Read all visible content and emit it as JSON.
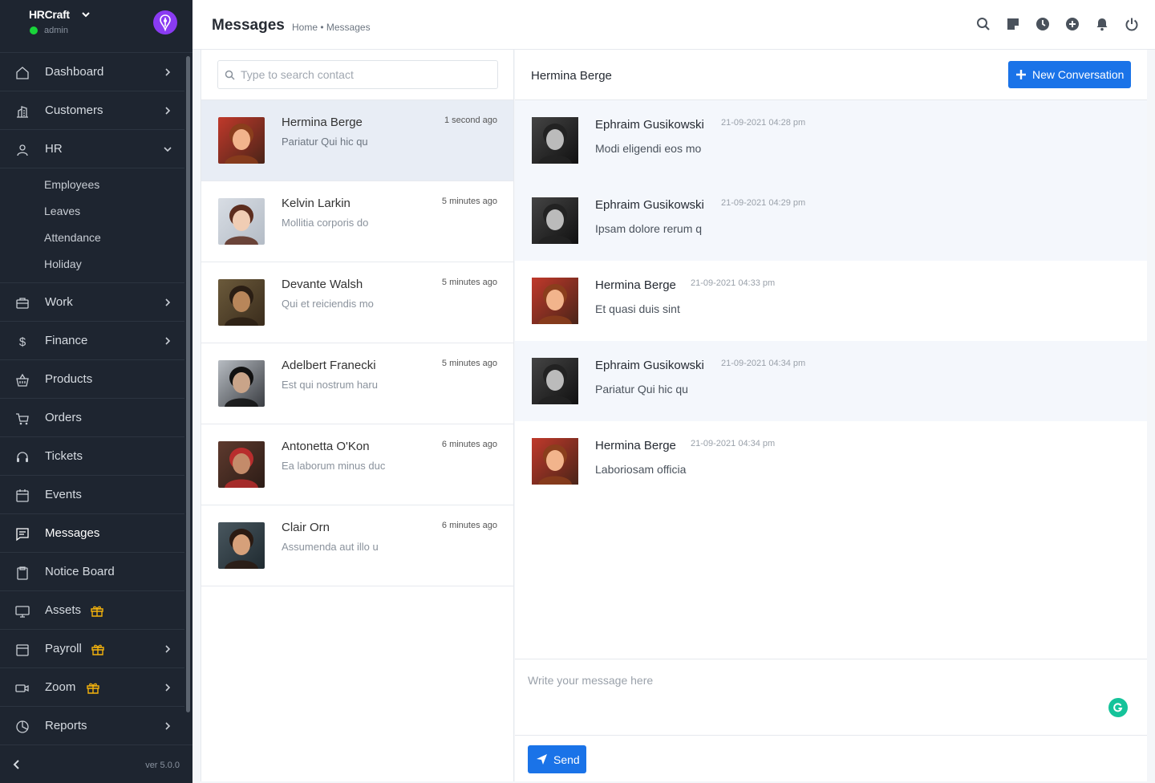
{
  "app": {
    "brand_name": "HRCraft",
    "user_role": "admin",
    "version": "ver 5.0.0",
    "accent_color": "#1a73e8",
    "sidebar_color": "#1e2530",
    "online_color": "#19d43a"
  },
  "sidebar": {
    "items": [
      {
        "label": "Dashboard",
        "icon": "home-icon"
      },
      {
        "label": "Customers",
        "icon": "building-icon"
      },
      {
        "label": "HR",
        "icon": "user-icon",
        "expanded": true,
        "children": [
          "Employees",
          "Leaves",
          "Attendance",
          "Holiday"
        ]
      },
      {
        "label": "Work",
        "icon": "briefcase-icon"
      },
      {
        "label": "Finance",
        "icon": "dollar-icon"
      },
      {
        "label": "Products",
        "icon": "basket-icon"
      },
      {
        "label": "Orders",
        "icon": "cart-icon"
      },
      {
        "label": "Tickets",
        "icon": "headset-icon"
      },
      {
        "label": "Events",
        "icon": "calendar-icon"
      },
      {
        "label": "Messages",
        "icon": "message-icon",
        "active": true
      },
      {
        "label": "Notice Board",
        "icon": "clipboard-icon"
      },
      {
        "label": "Assets",
        "icon": "monitor-icon",
        "badge": "gift-icon"
      },
      {
        "label": "Payroll",
        "icon": "wallet-icon",
        "badge": "gift-icon"
      },
      {
        "label": "Zoom",
        "icon": "video-icon",
        "badge": "gift-icon"
      },
      {
        "label": "Reports",
        "icon": "pie-chart-icon"
      }
    ]
  },
  "header": {
    "title": "Messages",
    "breadcrumb": "Home • Messages",
    "icons": [
      "search-icon",
      "sticky-note-icon",
      "clock-icon",
      "plus-circle-icon",
      "bell-icon",
      "power-icon"
    ]
  },
  "contacts": {
    "search_placeholder": "Type to search contact",
    "list": [
      {
        "name": "Hermina Berge",
        "preview": "Pariatur Qui hic qu",
        "time": "1 second ago",
        "active": true
      },
      {
        "name": "Kelvin Larkin",
        "preview": "Mollitia corporis do",
        "time": "5 minutes ago"
      },
      {
        "name": "Devante Walsh",
        "preview": "Qui et reiciendis mo",
        "time": "5 minutes ago"
      },
      {
        "name": "Adelbert Franecki",
        "preview": "Est qui nostrum haru",
        "time": "5 minutes ago"
      },
      {
        "name": "Antonetta O'Kon",
        "preview": "Ea laborum minus duc",
        "time": "6 minutes ago"
      },
      {
        "name": "Clair Orn",
        "preview": "Assumenda aut illo u",
        "time": "6 minutes ago"
      }
    ]
  },
  "chat": {
    "title": "Hermina Berge",
    "new_conversation_label": "New Conversation",
    "messages": [
      {
        "sender": "Ephraim Gusikowski",
        "time": "21-09-2021 04:28 pm",
        "text": "Modi eligendi eos mo"
      },
      {
        "sender": "Ephraim Gusikowski",
        "time": "21-09-2021 04:29 pm",
        "text": "Ipsam dolore rerum q"
      },
      {
        "sender": "Hermina Berge",
        "time": "21-09-2021 04:33 pm",
        "text": "Et quasi duis sint"
      },
      {
        "sender": "Ephraim Gusikowski",
        "time": "21-09-2021 04:34 pm",
        "text": "Pariatur Qui hic qu"
      },
      {
        "sender": "Hermina Berge",
        "time": "21-09-2021 04:34 pm",
        "text": "Laboriosam officia"
      }
    ],
    "composer_placeholder": "Write your message here",
    "send_label": "Send"
  }
}
